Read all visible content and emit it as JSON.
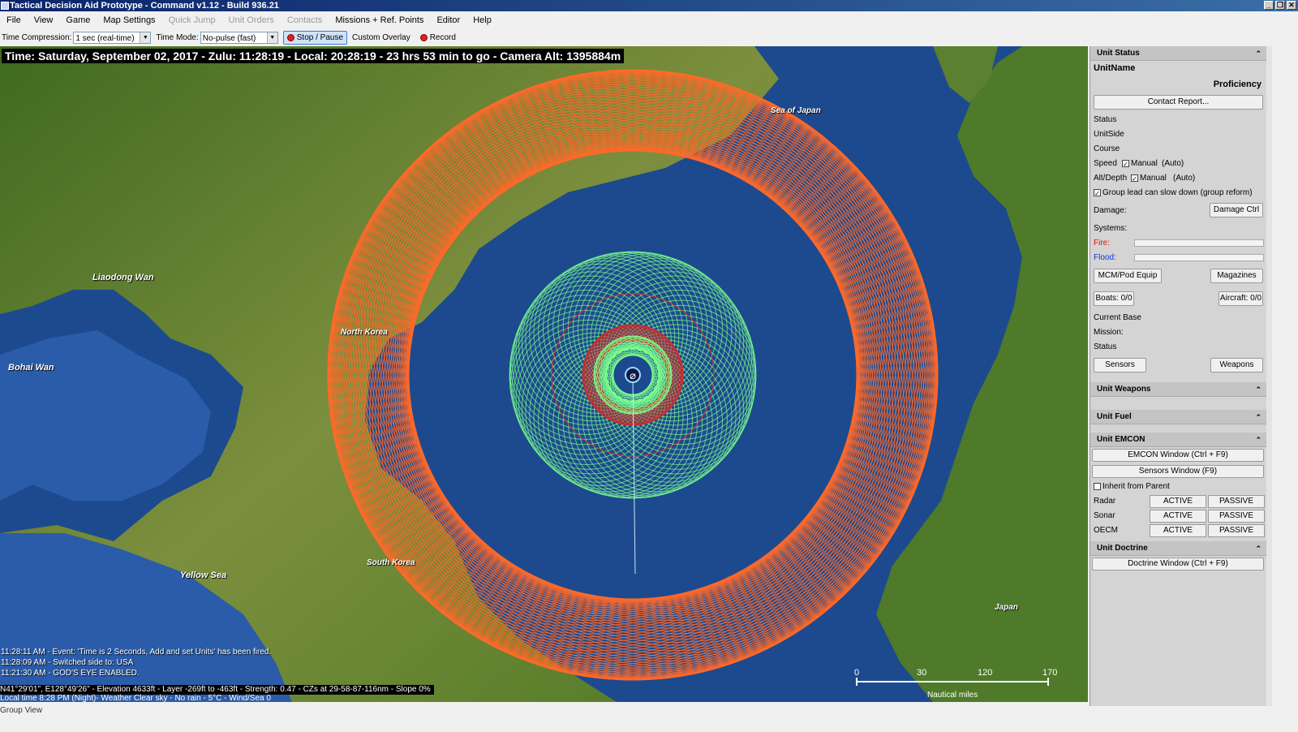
{
  "window": {
    "title": "Tactical Decision Aid Prototype - Command v1.12 - Build 936.21"
  },
  "menu": [
    {
      "label": "File",
      "enabled": true
    },
    {
      "label": "View",
      "enabled": true
    },
    {
      "label": "Game",
      "enabled": true
    },
    {
      "label": "Map Settings",
      "enabled": true
    },
    {
      "label": "Quick Jump",
      "enabled": false
    },
    {
      "label": "Unit Orders",
      "enabled": false
    },
    {
      "label": "Contacts",
      "enabled": false
    },
    {
      "label": "Missions + Ref. Points",
      "enabled": true
    },
    {
      "label": "Editor",
      "enabled": true
    },
    {
      "label": "Help",
      "enabled": true
    }
  ],
  "toolbar": {
    "time_compression_label": "Time Compression:",
    "time_compression_value": "1 sec (real-time)",
    "time_mode_label": "Time Mode:",
    "time_mode_value": "No-pulse (fast)",
    "stop_pause": "Stop / Pause",
    "custom_overlay": "Custom Overlay",
    "record": "Record"
  },
  "map": {
    "time_bar": "Time: Saturday, September 02, 2017 - Zulu: 11:28:19 - Local: 20:28:19 - 23 hrs 53 min to go -  Camera Alt: 1395884m",
    "labels": {
      "sea_of_japan": "Sea of Japan",
      "liaodong_wan": "Liaodong Wan",
      "north_korea": "North Korea",
      "bohai_wan": "Bohai Wan",
      "south_korea": "South Korea",
      "yellow_sea": "Yellow Sea",
      "japan": "Japan"
    },
    "events": [
      "11:28:11 AM - Event: 'Time is 2 Seconds, Add and set Units' has been fired.",
      "11:28:09 AM - Switched side to: USA",
      "11:21:30 AM - GOD'S EYE ENABLED."
    ],
    "status_line_1": "N41°29'01\", E128°49'26\" - Elevation 4633ft - Layer -269ft to -463ft - Strength: 0.47 - CZs at 29-58-87-116nm - Slope 0%",
    "status_line_2": "Local time 8:28 PM (Night)- Weather Clear sky - No rain - 5°C - Wind/Sea 0",
    "scale": {
      "ticks": [
        "0",
        "30",
        "120",
        "170"
      ],
      "unit": "Nautical miles"
    }
  },
  "footer": {
    "group_view": "Group View"
  },
  "panel": {
    "unit_status": "Unit Status",
    "unit_name": "UnitName",
    "proficiency": "Proficiency",
    "contact_report": "Contact Report...",
    "status": "Status",
    "unit_side": "UnitSide",
    "course": "Course",
    "speed": "Speed",
    "alt_depth": "Alt/Depth",
    "manual": "Manual",
    "auto": "(Auto)",
    "group_lead": "Group lead can slow down (group reform)",
    "damage": "Damage:",
    "damage_ctrl": "Damage Ctrl",
    "systems": "Systems:",
    "fire": "Fire:",
    "flood": "Flood:",
    "mcm_pod": "MCM/Pod Equip",
    "magazines": "Magazines",
    "boats": "Boats: 0/0",
    "aircraft": "Aircraft: 0/0",
    "current_base": "Current Base",
    "mission": "Mission:",
    "status2": "Status",
    "sensors": "Sensors",
    "weapons": "Weapons",
    "unit_weapons": "Unit Weapons",
    "unit_fuel": "Unit Fuel",
    "unit_emcon": "Unit EMCON",
    "emcon_window": "EMCON Window (Ctrl + F9)",
    "sensors_window": "Sensors Window (F9)",
    "inherit": "Inherit from Parent",
    "emcon_rows": [
      {
        "label": "Radar",
        "active": "ACTIVE",
        "passive": "PASSIVE"
      },
      {
        "label": "Sonar",
        "active": "ACTIVE",
        "passive": "PASSIVE"
      },
      {
        "label": "OECM",
        "active": "ACTIVE",
        "passive": "PASSIVE"
      }
    ],
    "unit_doctrine": "Unit Doctrine",
    "doctrine_window": "Doctrine Window (Ctrl + F9)"
  },
  "colors": {
    "range_orange": "#ff6a2a",
    "sensor_green": "#7cff8c",
    "ring_red": "#e02020",
    "sea": "#1b3f8a",
    "land": "#4e7a2a"
  }
}
